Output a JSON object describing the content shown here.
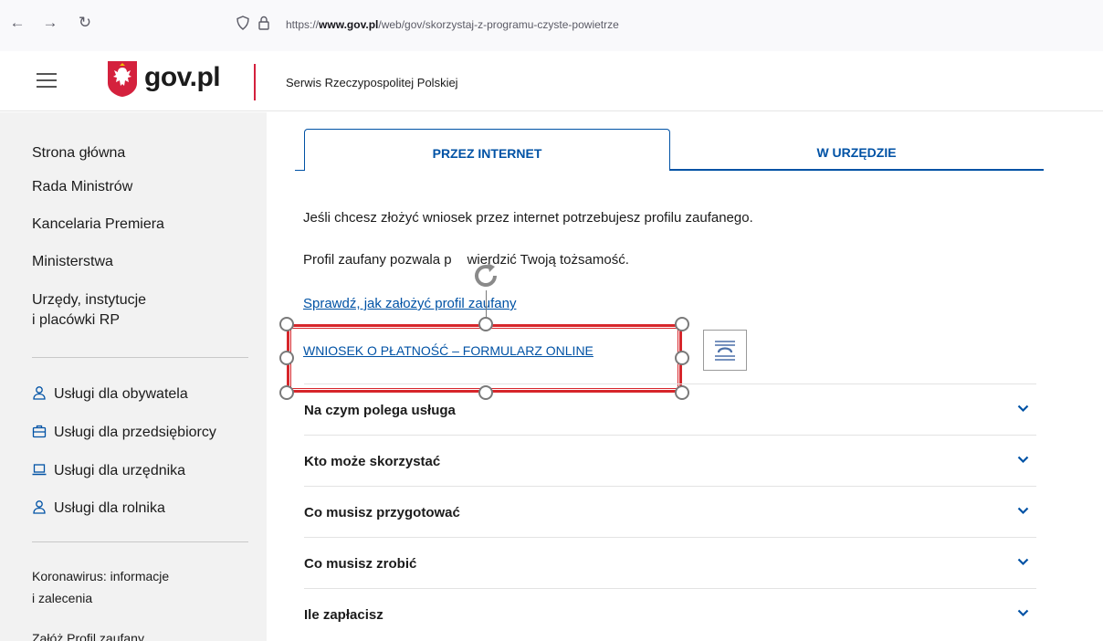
{
  "browser": {
    "url_prefix": "https://",
    "url_domain": "www.gov.pl",
    "url_path": "/web/gov/skorzystaj-z-programu-czyste-powietrze"
  },
  "header": {
    "logo_text": "gov.pl",
    "subtitle": "Serwis Rzeczypospolitej Polskiej"
  },
  "sidebar": {
    "main_links": [
      "Strona główna",
      "Rada Ministrów",
      "Kancelaria Premiera",
      "Ministerstwa"
    ],
    "offices_line1": "Urzędy, instytucje",
    "offices_line2": "i placówki RP",
    "services": [
      {
        "label": "Usługi dla obywatela",
        "icon": "person-icon"
      },
      {
        "label": "Usługi dla przedsiębiorcy",
        "icon": "briefcase-icon"
      },
      {
        "label": "Usługi dla urzędnika",
        "icon": "laptop-icon"
      },
      {
        "label": "Usługi dla rolnika",
        "icon": "person-icon"
      }
    ],
    "covid_line1": "Koronawirus: informacje",
    "covid_line2": "i zalecenia",
    "profile_link": "Załóż Profil zaufany"
  },
  "tabs": {
    "active": "PRZEZ INTERNET",
    "inactive": "W URZĘDZIE"
  },
  "content": {
    "para1": "Jeśli chcesz złożyć wniosek przez internet potrzebujesz profilu zaufanego.",
    "para2_start": "Profil zaufany pozwala p",
    "para2_end": "wierdzić Twoją tożsamość.",
    "link_check": "Sprawdź, jak założyć profil zaufany",
    "link_form": "WNIOSEK O PŁATNOŚĆ – FORMULARZ ONLINE"
  },
  "accordion": [
    "Na czym polega usługa",
    "Kto może skorzystać",
    "Co musisz przygotować",
    "Co musisz zrobić",
    "Ile zapłacisz"
  ],
  "colors": {
    "brand_blue": "#0052a5",
    "accent_red": "#d4213d",
    "selection_red": "#d7262b",
    "sidebar_bg": "#f2f2f2"
  }
}
